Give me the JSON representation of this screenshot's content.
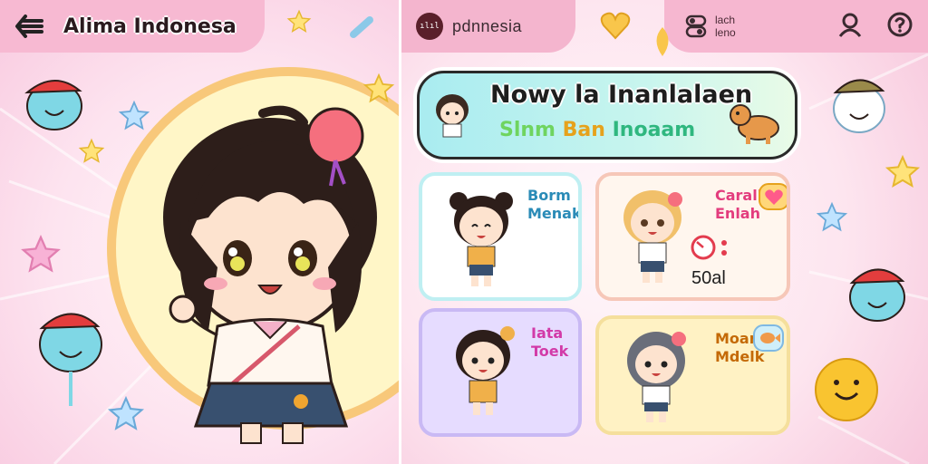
{
  "left_header": {
    "title": "Alima Indonesa"
  },
  "right_header": {
    "app_badge": "ılıl",
    "search_value": "pdnnesia",
    "lang_options": [
      "lach",
      "leno"
    ]
  },
  "banner": {
    "line1": "Nowy la Inanlalaen",
    "line2_words": [
      "Slnm",
      "Ban",
      "Inoaam"
    ]
  },
  "cards": [
    {
      "label_lines": [
        "Borm",
        "Menak"
      ],
      "value": ""
    },
    {
      "label_lines": [
        "Caralk",
        "Enlah"
      ],
      "value": "50al"
    },
    {
      "label_lines": [
        "Iata",
        "Toek"
      ],
      "value": ""
    },
    {
      "label_lines": [
        "Moan",
        "Mdelk"
      ],
      "value": ""
    }
  ],
  "icons": {
    "back": "back-arrow-icon",
    "language": "language-icon",
    "profile": "profile-icon",
    "help": "help-icon",
    "timer": "timer-icon",
    "heart": "heart-icon",
    "fish": "fish-icon"
  },
  "colors": {
    "header_pink": "#f7b9d2",
    "banner_teal": "#a9ecf0",
    "card_blue_label": "#2a8bb7",
    "card_pink_label": "#e33c7d",
    "card_purple_label": "#d23aa8",
    "card_orange_label": "#c46a07"
  }
}
